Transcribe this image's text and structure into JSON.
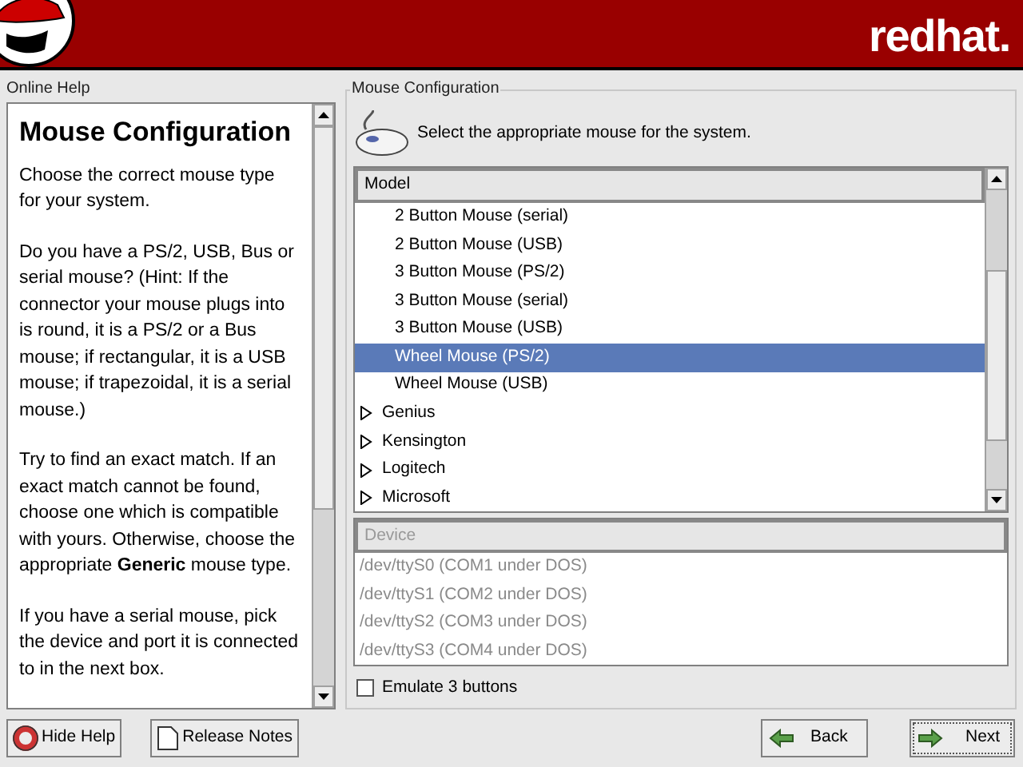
{
  "header": {
    "logo_text": "redhat."
  },
  "help": {
    "title": "Online Help",
    "heading": "Mouse Configuration",
    "paragraphs": [
      "Choose the correct mouse type for your system.",
      "Do you have a PS/2, USB, Bus or serial mouse? (Hint: If the connector your mouse plugs into is round, it is a PS/2 or a Bus mouse; if rectangular, it is a USB mouse; if trapezoidal, it is a serial mouse.)",
      "Try to find an exact match. If an exact match cannot be found, choose one which is compatible with yours. Otherwise, choose the appropriate **Generic** mouse type.",
      "If you have a serial mouse, pick the device and port it is connected to in the next box."
    ]
  },
  "config": {
    "title": "Mouse Configuration",
    "intro": "Select the appropriate mouse for the system.",
    "model_column": "Model",
    "models": [
      {
        "kind": "item",
        "label": "2 Button Mouse (serial)",
        "selected": false
      },
      {
        "kind": "item",
        "label": "2 Button Mouse (USB)",
        "selected": false
      },
      {
        "kind": "item",
        "label": "3 Button Mouse (PS/2)",
        "selected": false
      },
      {
        "kind": "item",
        "label": "3 Button Mouse (serial)",
        "selected": false
      },
      {
        "kind": "item",
        "label": "3 Button Mouse (USB)",
        "selected": false
      },
      {
        "kind": "item",
        "label": "Wheel Mouse (PS/2)",
        "selected": true
      },
      {
        "kind": "item",
        "label": "Wheel Mouse (USB)",
        "selected": false
      },
      {
        "kind": "group",
        "label": "Genius",
        "selected": false,
        "expanded": false
      },
      {
        "kind": "group",
        "label": "Kensington",
        "selected": false,
        "expanded": false
      },
      {
        "kind": "group",
        "label": "Logitech",
        "selected": false,
        "expanded": false
      },
      {
        "kind": "group",
        "label": "Microsoft",
        "selected": false,
        "expanded": false
      }
    ],
    "device_column": "Device",
    "devices_disabled": true,
    "devices": [
      "/dev/ttyS0 (COM1 under DOS)",
      "/dev/ttyS1 (COM2 under DOS)",
      "/dev/ttyS2 (COM3 under DOS)",
      "/dev/ttyS3 (COM4 under DOS)"
    ],
    "emulate": {
      "label": "Emulate 3 buttons",
      "checked": false
    }
  },
  "buttons": {
    "hide_help": "Hide Help",
    "release_notes": "Release Notes",
    "back": "Back",
    "next": "Next"
  }
}
